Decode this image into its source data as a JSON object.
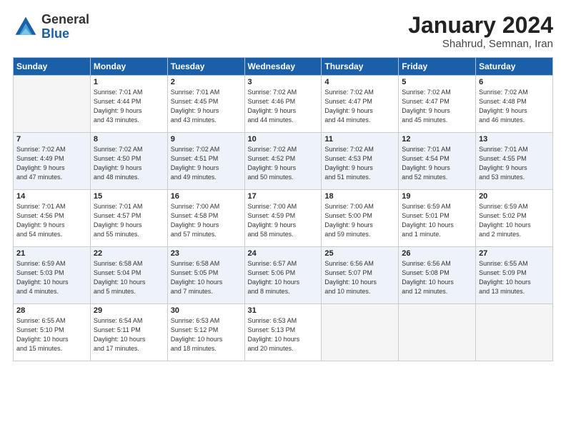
{
  "header": {
    "logo": {
      "general": "General",
      "blue": "Blue"
    },
    "title": "January 2024",
    "location": "Shahrud, Semnan, Iran"
  },
  "days_of_week": [
    "Sunday",
    "Monday",
    "Tuesday",
    "Wednesday",
    "Thursday",
    "Friday",
    "Saturday"
  ],
  "weeks": [
    [
      {
        "num": "",
        "info": ""
      },
      {
        "num": "1",
        "info": "Sunrise: 7:01 AM\nSunset: 4:44 PM\nDaylight: 9 hours\nand 43 minutes."
      },
      {
        "num": "2",
        "info": "Sunrise: 7:01 AM\nSunset: 4:45 PM\nDaylight: 9 hours\nand 43 minutes."
      },
      {
        "num": "3",
        "info": "Sunrise: 7:02 AM\nSunset: 4:46 PM\nDaylight: 9 hours\nand 44 minutes."
      },
      {
        "num": "4",
        "info": "Sunrise: 7:02 AM\nSunset: 4:47 PM\nDaylight: 9 hours\nand 44 minutes."
      },
      {
        "num": "5",
        "info": "Sunrise: 7:02 AM\nSunset: 4:47 PM\nDaylight: 9 hours\nand 45 minutes."
      },
      {
        "num": "6",
        "info": "Sunrise: 7:02 AM\nSunset: 4:48 PM\nDaylight: 9 hours\nand 46 minutes."
      }
    ],
    [
      {
        "num": "7",
        "info": "Sunrise: 7:02 AM\nSunset: 4:49 PM\nDaylight: 9 hours\nand 47 minutes."
      },
      {
        "num": "8",
        "info": "Sunrise: 7:02 AM\nSunset: 4:50 PM\nDaylight: 9 hours\nand 48 minutes."
      },
      {
        "num": "9",
        "info": "Sunrise: 7:02 AM\nSunset: 4:51 PM\nDaylight: 9 hours\nand 49 minutes."
      },
      {
        "num": "10",
        "info": "Sunrise: 7:02 AM\nSunset: 4:52 PM\nDaylight: 9 hours\nand 50 minutes."
      },
      {
        "num": "11",
        "info": "Sunrise: 7:02 AM\nSunset: 4:53 PM\nDaylight: 9 hours\nand 51 minutes."
      },
      {
        "num": "12",
        "info": "Sunrise: 7:01 AM\nSunset: 4:54 PM\nDaylight: 9 hours\nand 52 minutes."
      },
      {
        "num": "13",
        "info": "Sunrise: 7:01 AM\nSunset: 4:55 PM\nDaylight: 9 hours\nand 53 minutes."
      }
    ],
    [
      {
        "num": "14",
        "info": "Sunrise: 7:01 AM\nSunset: 4:56 PM\nDaylight: 9 hours\nand 54 minutes."
      },
      {
        "num": "15",
        "info": "Sunrise: 7:01 AM\nSunset: 4:57 PM\nDaylight: 9 hours\nand 55 minutes."
      },
      {
        "num": "16",
        "info": "Sunrise: 7:00 AM\nSunset: 4:58 PM\nDaylight: 9 hours\nand 57 minutes."
      },
      {
        "num": "17",
        "info": "Sunrise: 7:00 AM\nSunset: 4:59 PM\nDaylight: 9 hours\nand 58 minutes."
      },
      {
        "num": "18",
        "info": "Sunrise: 7:00 AM\nSunset: 5:00 PM\nDaylight: 9 hours\nand 59 minutes."
      },
      {
        "num": "19",
        "info": "Sunrise: 6:59 AM\nSunset: 5:01 PM\nDaylight: 10 hours\nand 1 minute."
      },
      {
        "num": "20",
        "info": "Sunrise: 6:59 AM\nSunset: 5:02 PM\nDaylight: 10 hours\nand 2 minutes."
      }
    ],
    [
      {
        "num": "21",
        "info": "Sunrise: 6:59 AM\nSunset: 5:03 PM\nDaylight: 10 hours\nand 4 minutes."
      },
      {
        "num": "22",
        "info": "Sunrise: 6:58 AM\nSunset: 5:04 PM\nDaylight: 10 hours\nand 5 minutes."
      },
      {
        "num": "23",
        "info": "Sunrise: 6:58 AM\nSunset: 5:05 PM\nDaylight: 10 hours\nand 7 minutes."
      },
      {
        "num": "24",
        "info": "Sunrise: 6:57 AM\nSunset: 5:06 PM\nDaylight: 10 hours\nand 8 minutes."
      },
      {
        "num": "25",
        "info": "Sunrise: 6:56 AM\nSunset: 5:07 PM\nDaylight: 10 hours\nand 10 minutes."
      },
      {
        "num": "26",
        "info": "Sunrise: 6:56 AM\nSunset: 5:08 PM\nDaylight: 10 hours\nand 12 minutes."
      },
      {
        "num": "27",
        "info": "Sunrise: 6:55 AM\nSunset: 5:09 PM\nDaylight: 10 hours\nand 13 minutes."
      }
    ],
    [
      {
        "num": "28",
        "info": "Sunrise: 6:55 AM\nSunset: 5:10 PM\nDaylight: 10 hours\nand 15 minutes."
      },
      {
        "num": "29",
        "info": "Sunrise: 6:54 AM\nSunset: 5:11 PM\nDaylight: 10 hours\nand 17 minutes."
      },
      {
        "num": "30",
        "info": "Sunrise: 6:53 AM\nSunset: 5:12 PM\nDaylight: 10 hours\nand 18 minutes."
      },
      {
        "num": "31",
        "info": "Sunrise: 6:53 AM\nSunset: 5:13 PM\nDaylight: 10 hours\nand 20 minutes."
      },
      {
        "num": "",
        "info": ""
      },
      {
        "num": "",
        "info": ""
      },
      {
        "num": "",
        "info": ""
      }
    ]
  ]
}
